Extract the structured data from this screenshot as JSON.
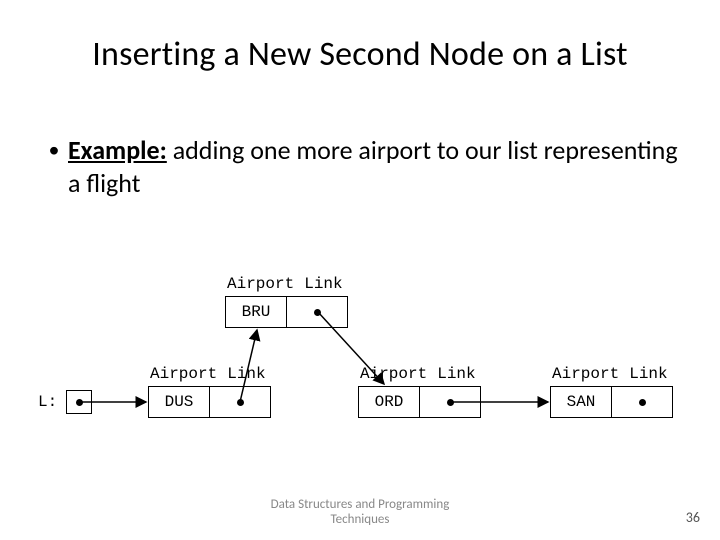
{
  "title": "Inserting a New Second Node on a List",
  "bullet": {
    "lead": "Example:",
    "rest": " adding one more airport to our list representing a flight"
  },
  "labels": {
    "airport": "Airport",
    "link": "Link",
    "head": "L:"
  },
  "nodes": {
    "new": {
      "airport": "BRU"
    },
    "n1": {
      "airport": "DUS"
    },
    "n2": {
      "airport": "ORD"
    },
    "n3": {
      "airport": "SAN"
    }
  },
  "footer": {
    "line1": "Data Structures and Programming",
    "line2": "Techniques"
  },
  "page": "36"
}
